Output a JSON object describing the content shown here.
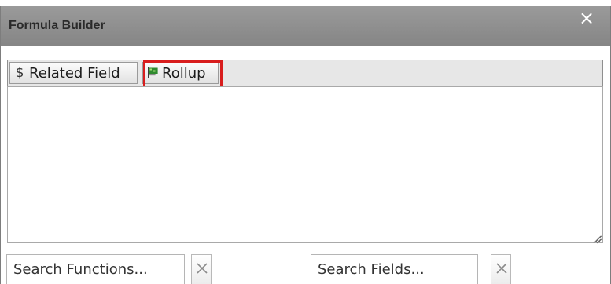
{
  "dialog": {
    "title": "Formula Builder",
    "close_glyph": "×",
    "close_icon": "close-icon"
  },
  "toolbar": {
    "buttons": [
      {
        "label": "Related Field",
        "icon": "dollar-icon",
        "icon_glyph": "$"
      },
      {
        "label": "Rollup",
        "icon": "flag-icon",
        "highlighted": true
      }
    ],
    "highlight_color": "#d81d1d"
  },
  "editor": {
    "value": "",
    "resize_icon": "resize-grip-icon"
  },
  "search": {
    "functions_placeholder": "Search Functions...",
    "fields_placeholder": "Search Fields...",
    "clear_icon": "clear-x-icon"
  },
  "colors": {
    "titlebar": "#8f8f8f",
    "toolbar_bg": "#e7e7e7",
    "close": "#ffffff"
  }
}
